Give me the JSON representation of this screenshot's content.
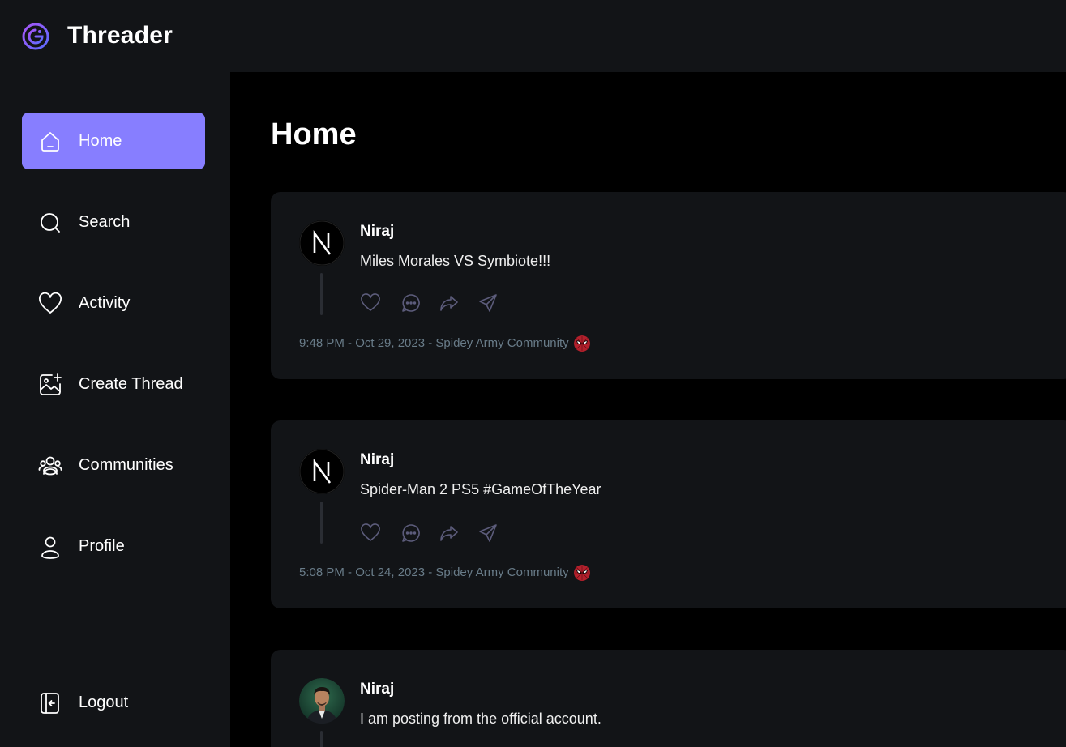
{
  "app": {
    "name": "Threader"
  },
  "sidebar": {
    "items": [
      {
        "label": "Home",
        "icon": "home-icon",
        "active": true
      },
      {
        "label": "Search",
        "icon": "search-icon",
        "active": false
      },
      {
        "label": "Activity",
        "icon": "heart-icon",
        "active": false
      },
      {
        "label": "Create Thread",
        "icon": "image-plus-icon",
        "active": false
      },
      {
        "label": "Communities",
        "icon": "users-icon",
        "active": false
      },
      {
        "label": "Profile",
        "icon": "user-icon",
        "active": false
      }
    ],
    "logout": {
      "label": "Logout",
      "icon": "logout-icon"
    }
  },
  "main": {
    "title": "Home",
    "threads": [
      {
        "author": "Niraj",
        "avatar": "nextjs-logo-avatar",
        "content": "Miles Morales VS Symbiote!!!",
        "meta": "9:48 PM - Oct 29, 2023 - Spidey Army Community",
        "community_icon": "spiderman-mask-icon"
      },
      {
        "author": "Niraj",
        "avatar": "nextjs-logo-avatar",
        "content": "Spider-Man 2 PS5 #GameOfTheYear",
        "meta": "5:08 PM - Oct 24, 2023 - Spidey Army Community",
        "community_icon": "spiderman-mask-icon"
      },
      {
        "author": "Niraj",
        "avatar": "user-photo-avatar",
        "content": "I am posting from the official account.",
        "meta": "",
        "community_icon": ""
      }
    ]
  },
  "colors": {
    "accent": "#877eff",
    "panel": "#121417",
    "background": "#000000",
    "meta_text": "#697c89"
  }
}
